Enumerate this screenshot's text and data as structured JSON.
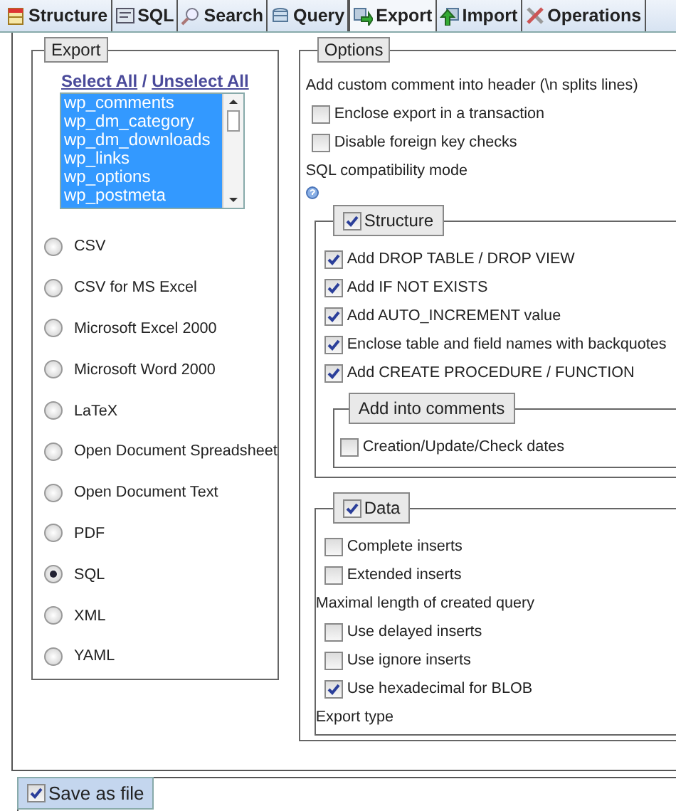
{
  "tabs": [
    {
      "label": "Structure",
      "selected": false
    },
    {
      "label": "SQL",
      "selected": false
    },
    {
      "label": "Search",
      "selected": false
    },
    {
      "label": "Query",
      "selected": false
    },
    {
      "label": "Export",
      "selected": true
    },
    {
      "label": "Import",
      "selected": false
    },
    {
      "label": "Operations",
      "selected": false
    }
  ],
  "export_panel": {
    "legend": "Export",
    "select_all": "Select All",
    "separator": "/",
    "unselect_all": "Unselect All",
    "tables": [
      {
        "label": "wp_comments",
        "selected": true
      },
      {
        "label": "wp_dm_category",
        "selected": true
      },
      {
        "label": "wp_dm_downloads",
        "selected": true
      },
      {
        "label": "wp_links",
        "selected": true
      },
      {
        "label": "wp_options",
        "selected": true
      },
      {
        "label": "wp_postmeta",
        "selected": true
      }
    ],
    "formats": [
      {
        "label": "CSV",
        "selected": false
      },
      {
        "label": "CSV for MS Excel",
        "selected": false
      },
      {
        "label": "Microsoft Excel 2000",
        "selected": false
      },
      {
        "label": "Microsoft Word 2000",
        "selected": false
      },
      {
        "label": "LaTeX",
        "selected": false
      },
      {
        "label": "Open Document Spreadsheet",
        "selected": false
      },
      {
        "label": "Open Document Text",
        "selected": false
      },
      {
        "label": "PDF",
        "selected": false
      },
      {
        "label": "SQL",
        "selected": true
      },
      {
        "label": "XML",
        "selected": false
      },
      {
        "label": "YAML",
        "selected": false
      }
    ]
  },
  "options": {
    "legend": "Options",
    "comment_label": "Add custom comment into header (\\n splits lines)",
    "checkboxes": [
      {
        "label": "Enclose export in a transaction",
        "checked": false
      },
      {
        "label": "Disable foreign key checks",
        "checked": false
      }
    ],
    "compat_label": "SQL compatibility mode",
    "structure": {
      "legend": "Structure",
      "checked": true,
      "options": [
        {
          "label": "Add DROP TABLE / DROP VIEW",
          "checked": true
        },
        {
          "label": "Add IF NOT EXISTS",
          "checked": true
        },
        {
          "label": "Add AUTO_INCREMENT value",
          "checked": true
        },
        {
          "label": "Enclose table and field names with backquotes",
          "checked": true
        },
        {
          "label": "Add CREATE PROCEDURE / FUNCTION",
          "checked": true
        }
      ],
      "comments": {
        "legend": "Add into comments",
        "options": [
          {
            "label": "Creation/Update/Check dates",
            "checked": false
          }
        ]
      }
    },
    "data": {
      "legend": "Data",
      "checked": true,
      "items": [
        {
          "kind": "checkbox",
          "label": "Complete inserts",
          "checked": false
        },
        {
          "kind": "checkbox",
          "label": "Extended inserts",
          "checked": false
        },
        {
          "kind": "label",
          "label": "Maximal length of created query"
        },
        {
          "kind": "checkbox",
          "label": "Use delayed inserts",
          "checked": false
        },
        {
          "kind": "checkbox",
          "label": "Use ignore inserts",
          "checked": false
        },
        {
          "kind": "checkbox",
          "label": "Use hexadecimal for BLOB",
          "checked": true
        },
        {
          "kind": "label",
          "label": "Export type"
        }
      ]
    }
  },
  "save_as_file": {
    "label": "Save as file",
    "checked": true
  }
}
